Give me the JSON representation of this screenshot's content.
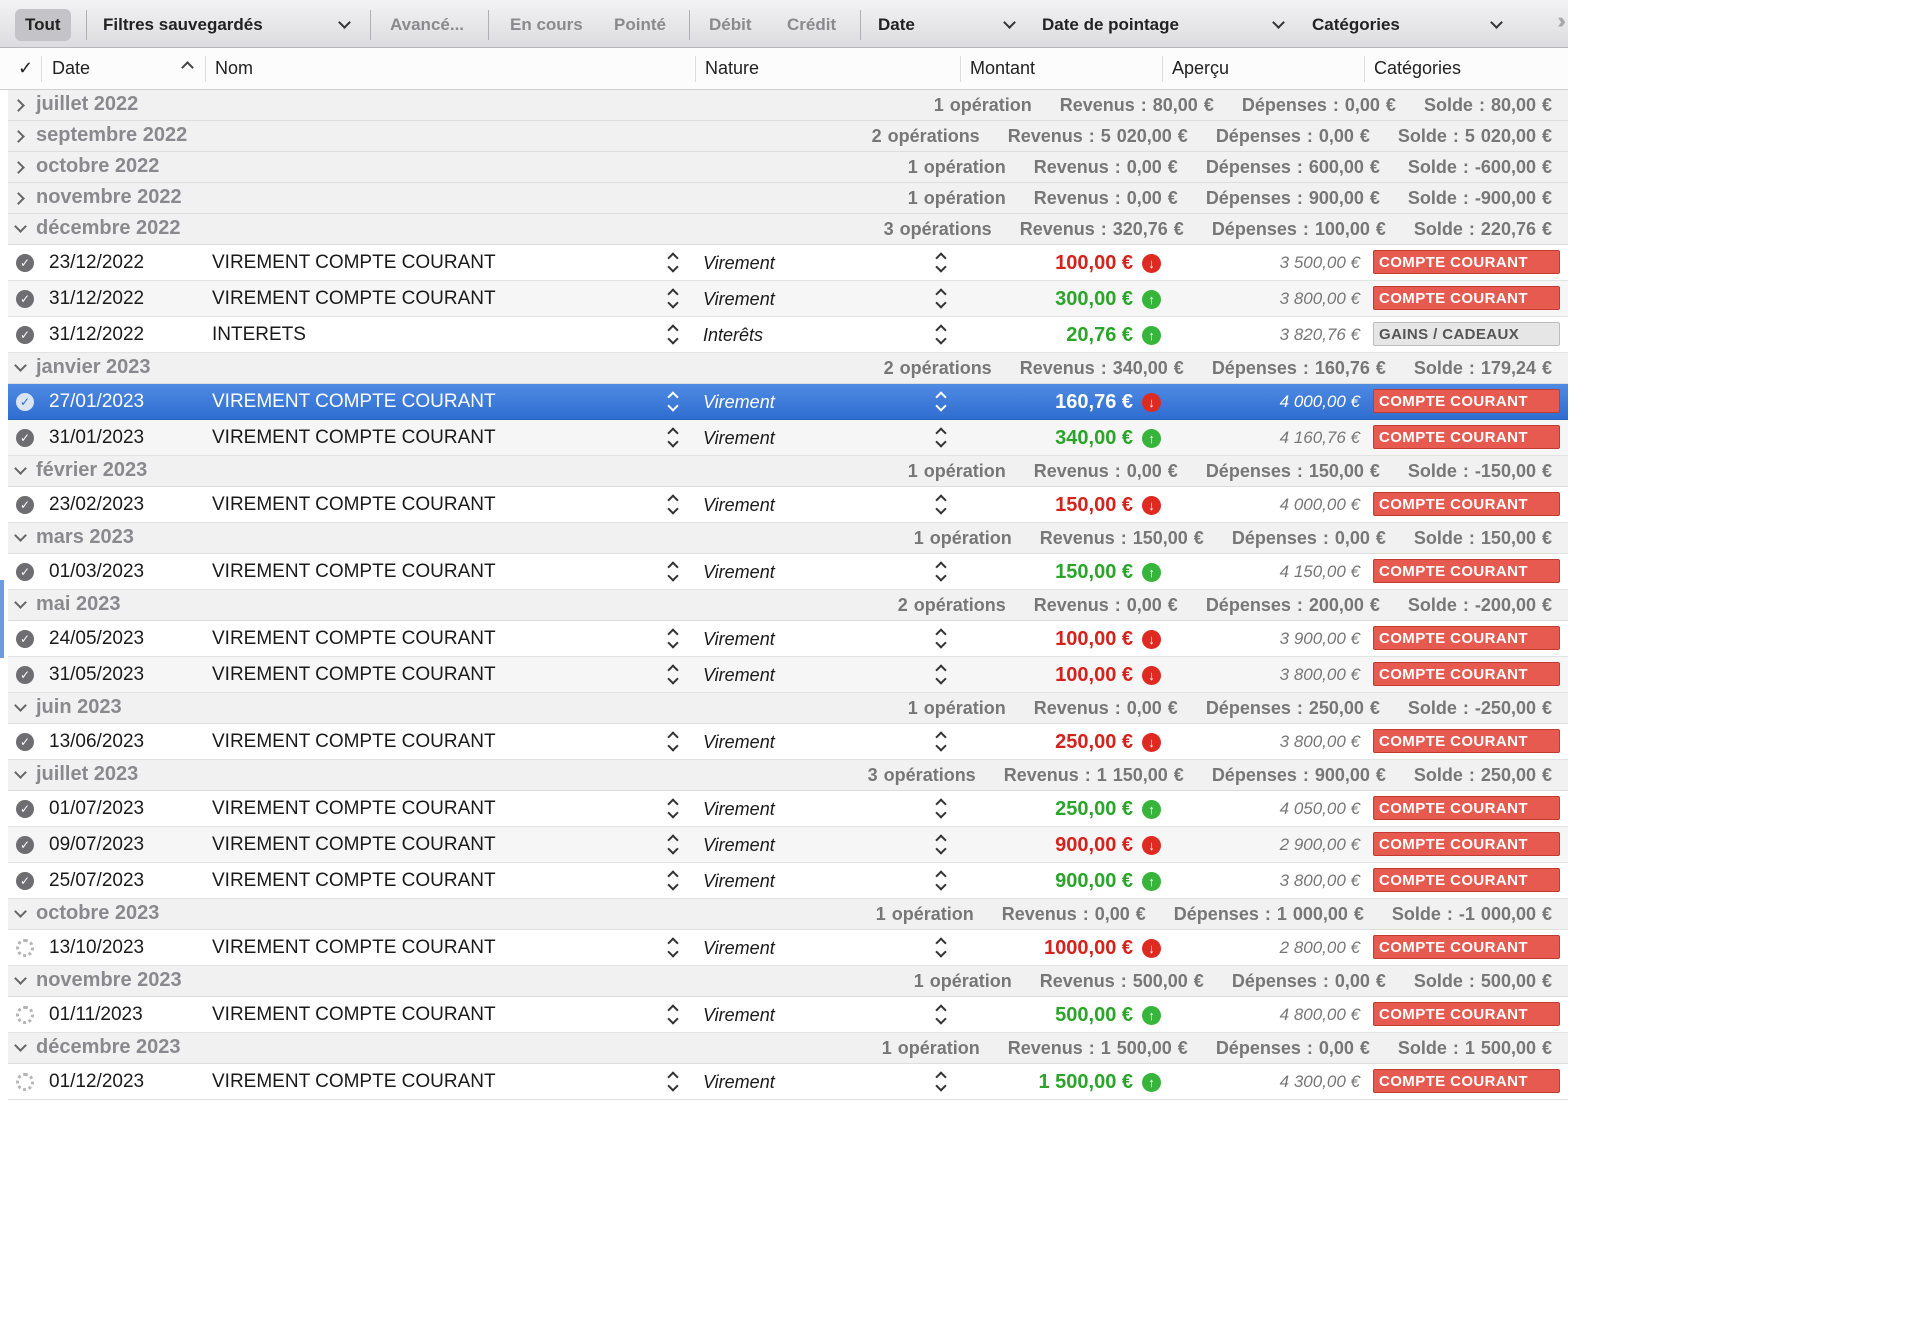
{
  "filters": {
    "all": "Tout",
    "saved": "Filtres sauvegardés",
    "advanced": "Avancé...",
    "in_progress": "En cours",
    "reconciled": "Pointé",
    "debit": "Débit",
    "credit": "Crédit",
    "date": "Date",
    "reconcile_date": "Date de pointage",
    "categories": "Catégories"
  },
  "columns": {
    "check": "✓",
    "date": "Date",
    "name": "Nom",
    "nature": "Nature",
    "amount": "Montant",
    "preview": "Aperçu",
    "categories": "Catégories"
  },
  "groups": [
    {
      "month": "juillet 2022",
      "expanded": false,
      "ops": "1 opération",
      "revenus": "Revenus : 80,00 €",
      "depenses": "Dépenses : 0,00 €",
      "solde": "Solde : 80,00 €",
      "transactions": []
    },
    {
      "month": "septembre 2022",
      "expanded": false,
      "ops": "2 opérations",
      "revenus": "Revenus : 5 020,00 €",
      "depenses": "Dépenses : 0,00 €",
      "solde": "Solde : 5 020,00 €",
      "transactions": []
    },
    {
      "month": "octobre 2022",
      "expanded": false,
      "ops": "1 opération",
      "revenus": "Revenus : 0,00 €",
      "depenses": "Dépenses : 600,00 €",
      "solde": "Solde : -600,00 €",
      "transactions": []
    },
    {
      "month": "novembre 2022",
      "expanded": false,
      "ops": "1 opération",
      "revenus": "Revenus : 0,00 €",
      "depenses": "Dépenses : 900,00 €",
      "solde": "Solde : -900,00 €",
      "transactions": []
    },
    {
      "month": "décembre 2022",
      "expanded": true,
      "ops": "3 opérations",
      "revenus": "Revenus : 320,76 €",
      "depenses": "Dépenses : 100,00 €",
      "solde": "Solde : 220,76 €",
      "transactions": [
        {
          "status": "done",
          "date": "23/12/2022",
          "name": "VIREMENT COMPTE COURANT",
          "nature": "Virement",
          "amount": "100,00 €",
          "dir": "out",
          "balance": "3 500,00 €",
          "category": "COMPTE COURANT",
          "cat_style": "red"
        },
        {
          "status": "done",
          "date": "31/12/2022",
          "name": "VIREMENT COMPTE COURANT",
          "nature": "Virement",
          "amount": "300,00 €",
          "dir": "in",
          "balance": "3 800,00 €",
          "category": "COMPTE COURANT",
          "cat_style": "red"
        },
        {
          "status": "done",
          "date": "31/12/2022",
          "name": "INTERETS",
          "nature": "Interêts",
          "amount": "20,76 €",
          "dir": "in",
          "balance": "3 820,76 €",
          "category": "GAINS / CADEAUX",
          "cat_style": "grey"
        }
      ]
    },
    {
      "month": "janvier 2023",
      "expanded": true,
      "ops": "2 opérations",
      "revenus": "Revenus : 340,00 €",
      "depenses": "Dépenses : 160,76 €",
      "solde": "Solde : 179,24 €",
      "transactions": [
        {
          "status": "done",
          "date": "27/01/2023",
          "name": "VIREMENT COMPTE COURANT",
          "nature": "Virement",
          "amount": "160,76 €",
          "dir": "out",
          "balance": "4 000,00 €",
          "category": "COMPTE COURANT",
          "cat_style": "red",
          "selected": true
        },
        {
          "status": "done",
          "date": "31/01/2023",
          "name": "VIREMENT COMPTE COURANT",
          "nature": "Virement",
          "amount": "340,00 €",
          "dir": "in",
          "balance": "4 160,76 €",
          "category": "COMPTE COURANT",
          "cat_style": "red"
        }
      ]
    },
    {
      "month": "février 2023",
      "expanded": true,
      "ops": "1 opération",
      "revenus": "Revenus : 0,00 €",
      "depenses": "Dépenses : 150,00 €",
      "solde": "Solde : -150,00 €",
      "transactions": [
        {
          "status": "done",
          "date": "23/02/2023",
          "name": "VIREMENT COMPTE COURANT",
          "nature": "Virement",
          "amount": "150,00 €",
          "dir": "out",
          "balance": "4 000,00 €",
          "category": "COMPTE COURANT",
          "cat_style": "red"
        }
      ]
    },
    {
      "month": "mars 2023",
      "expanded": true,
      "ops": "1 opération",
      "revenus": "Revenus : 150,00 €",
      "depenses": "Dépenses : 0,00 €",
      "solde": "Solde : 150,00 €",
      "transactions": [
        {
          "status": "done",
          "date": "01/03/2023",
          "name": "VIREMENT COMPTE COURANT",
          "nature": "Virement",
          "amount": "150,00 €",
          "dir": "in",
          "balance": "4 150,00 €",
          "category": "COMPTE COURANT",
          "cat_style": "red"
        }
      ]
    },
    {
      "month": "mai 2023",
      "expanded": true,
      "ops": "2 opérations",
      "revenus": "Revenus : 0,00 €",
      "depenses": "Dépenses : 200,00 €",
      "solde": "Solde : -200,00 €",
      "transactions": [
        {
          "status": "done",
          "date": "24/05/2023",
          "name": "VIREMENT COMPTE COURANT",
          "nature": "Virement",
          "amount": "100,00 €",
          "dir": "out",
          "balance": "3 900,00 €",
          "category": "COMPTE COURANT",
          "cat_style": "red"
        },
        {
          "status": "done",
          "date": "31/05/2023",
          "name": "VIREMENT COMPTE COURANT",
          "nature": "Virement",
          "amount": "100,00 €",
          "dir": "out",
          "balance": "3 800,00 €",
          "category": "COMPTE COURANT",
          "cat_style": "red"
        }
      ]
    },
    {
      "month": "juin 2023",
      "expanded": true,
      "ops": "1 opération",
      "revenus": "Revenus : 0,00 €",
      "depenses": "Dépenses : 250,00 €",
      "solde": "Solde : -250,00 €",
      "transactions": [
        {
          "status": "done",
          "date": "13/06/2023",
          "name": "VIREMENT COMPTE COURANT",
          "nature": "Virement",
          "amount": "250,00 €",
          "dir": "out",
          "balance": "3 800,00 €",
          "category": "COMPTE COURANT",
          "cat_style": "red"
        }
      ]
    },
    {
      "month": "juillet 2023",
      "expanded": true,
      "ops": "3 opérations",
      "revenus": "Revenus : 1 150,00 €",
      "depenses": "Dépenses : 900,00 €",
      "solde": "Solde : 250,00 €",
      "transactions": [
        {
          "status": "done",
          "date": "01/07/2023",
          "name": "VIREMENT COMPTE COURANT",
          "nature": "Virement",
          "amount": "250,00 €",
          "dir": "in",
          "balance": "4 050,00 €",
          "category": "COMPTE COURANT",
          "cat_style": "red"
        },
        {
          "status": "done",
          "date": "09/07/2023",
          "name": "VIREMENT COMPTE COURANT",
          "nature": "Virement",
          "amount": "900,00 €",
          "dir": "out",
          "balance": "2 900,00 €",
          "category": "COMPTE COURANT",
          "cat_style": "red"
        },
        {
          "status": "done",
          "date": "25/07/2023",
          "name": "VIREMENT COMPTE COURANT",
          "nature": "Virement",
          "amount": "900,00 €",
          "dir": "in",
          "balance": "3 800,00 €",
          "category": "COMPTE COURANT",
          "cat_style": "red"
        }
      ]
    },
    {
      "month": "octobre 2023",
      "expanded": true,
      "ops": "1 opération",
      "revenus": "Revenus : 0,00 €",
      "depenses": "Dépenses : 1 000,00 €",
      "solde": "Solde : -1 000,00 €",
      "transactions": [
        {
          "status": "pending",
          "date": "13/10/2023",
          "name": "VIREMENT COMPTE COURANT",
          "nature": "Virement",
          "amount": "1000,00 €",
          "dir": "out",
          "balance": "2 800,00 €",
          "category": "COMPTE COURANT",
          "cat_style": "red"
        }
      ]
    },
    {
      "month": "novembre 2023",
      "expanded": true,
      "ops": "1 opération",
      "revenus": "Revenus : 500,00 €",
      "depenses": "Dépenses : 0,00 €",
      "solde": "Solde : 500,00 €",
      "transactions": [
        {
          "status": "pending",
          "date": "01/11/2023",
          "name": "VIREMENT COMPTE COURANT",
          "nature": "Virement",
          "amount": "500,00 €",
          "dir": "in",
          "balance": "4 800,00 €",
          "category": "COMPTE COURANT",
          "cat_style": "red"
        }
      ]
    },
    {
      "month": "décembre 2023",
      "expanded": true,
      "ops": "1 opération",
      "revenus": "Revenus : 1 500,00 €",
      "depenses": "Dépenses : 0,00 €",
      "solde": "Solde : 1 500,00 €",
      "transactions": [
        {
          "status": "pending",
          "date": "01/12/2023",
          "name": "VIREMENT COMPTE COURANT",
          "nature": "Virement",
          "amount": "1 500,00 €",
          "dir": "in",
          "balance": "4 300,00 €",
          "category": "COMPTE COURANT",
          "cat_style": "red"
        }
      ]
    }
  ]
}
